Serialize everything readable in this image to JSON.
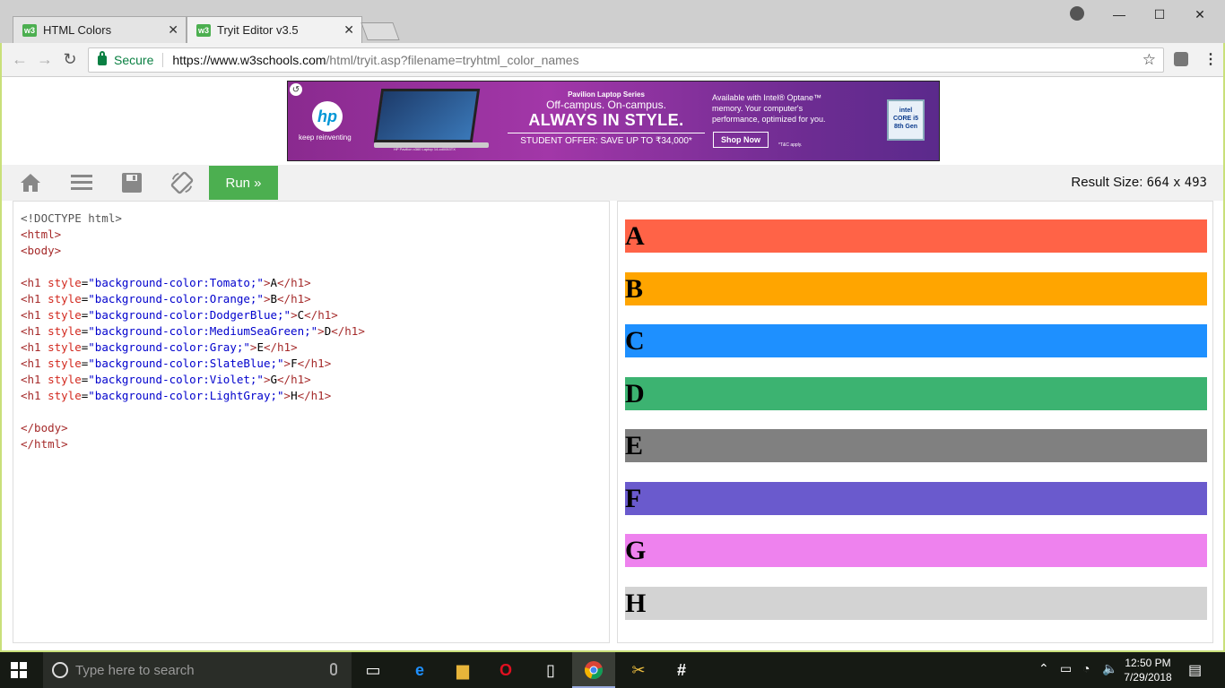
{
  "browser": {
    "tabs": [
      {
        "title": "HTML Colors",
        "favicon": "w3"
      },
      {
        "title": "Tryit Editor v3.5",
        "favicon": "w3"
      }
    ],
    "secure_label": "Secure",
    "url_host": "https://www.w3schools.com",
    "url_path": "/html/tryit.asp?filename=tryhtml_color_names",
    "window_controls": [
      "minimize-icon",
      "maximize-icon",
      "close-icon"
    ]
  },
  "ad": {
    "brand": "hp",
    "tagline": "keep reinventing",
    "series": "Pavilion Laptop Series",
    "offcampus": "Off-campus. On-campus.",
    "headline": "ALWAYS IN STYLE.",
    "offer": "STUDENT OFFER: SAVE UP TO ₹34,000*",
    "right_text_1": "Available with Intel® Optane™",
    "right_text_2": "memory. Your computer's",
    "right_text_3": "performance, optimized for you.",
    "shop": "Shop Now",
    "tc": "*T&C apply.",
    "intel": "intel",
    "intel_core": "CORE i5",
    "intel_gen": "8th Gen",
    "laptop_caption": "HP Pavilion x360 Laptop 14-cd0053TX"
  },
  "editor": {
    "run_label": "Run »",
    "result_size_label": "Result Size:",
    "result_width": "664",
    "result_x": "x",
    "result_height": "493",
    "code": {
      "doctype": "<!DOCTYPE html>",
      "html_open": "<html>",
      "body_open": "<body>",
      "body_close": "</body>",
      "html_close": "</html>",
      "h1_lines": [
        {
          "color": "Tomato",
          "letter": "A"
        },
        {
          "color": "Orange",
          "letter": "B"
        },
        {
          "color": "DodgerBlue",
          "letter": "C"
        },
        {
          "color": "MediumSeaGreen",
          "letter": "D"
        },
        {
          "color": "Gray",
          "letter": "E"
        },
        {
          "color": "SlateBlue",
          "letter": "F"
        },
        {
          "color": "Violet",
          "letter": "G"
        },
        {
          "color": "LightGray",
          "letter": "H"
        }
      ]
    }
  },
  "result": {
    "headings": [
      {
        "letter": "A",
        "color": "#ff6347"
      },
      {
        "letter": "B",
        "color": "#ffa500"
      },
      {
        "letter": "C",
        "color": "#1e90ff"
      },
      {
        "letter": "D",
        "color": "#3cb371"
      },
      {
        "letter": "E",
        "color": "#808080"
      },
      {
        "letter": "F",
        "color": "#6a5acd"
      },
      {
        "letter": "G",
        "color": "#ee82ee"
      },
      {
        "letter": "H",
        "color": "#d3d3d3"
      }
    ]
  },
  "taskbar": {
    "search_placeholder": "Type here to search",
    "time": "12:50 PM",
    "date": "7/29/2018"
  }
}
